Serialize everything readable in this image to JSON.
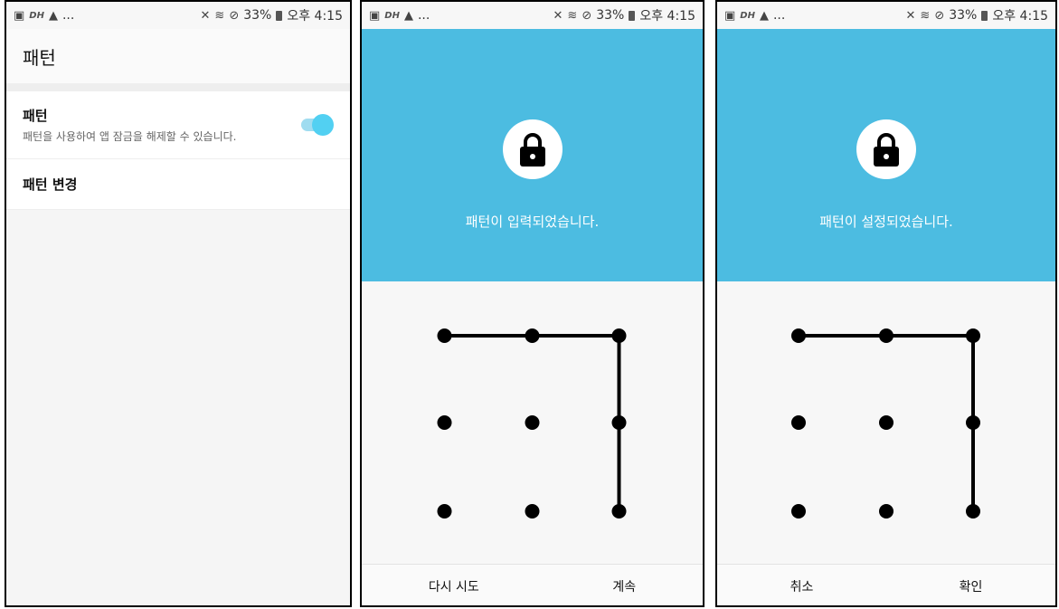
{
  "status_bar": {
    "left_icons": [
      "image-icon",
      "dh-icon",
      "warning-icon"
    ],
    "dh_text": "DH",
    "more": "...",
    "battery": "33%",
    "time": "오후 4:15"
  },
  "screen1": {
    "title": "패턴",
    "pattern_toggle": {
      "title": "패턴",
      "subtitle": "패턴을 사용하여 앱 잠금을 해제할 수 있습니다.",
      "enabled": true
    },
    "change_pattern": "패턴 변경"
  },
  "screen2": {
    "message": "패턴이 입력되었습니다.",
    "retry_button": "다시 시도",
    "continue_button": "계속",
    "pattern": [
      1,
      2,
      3,
      6,
      9
    ]
  },
  "screen3": {
    "message": "패턴이 설정되었습니다.",
    "cancel_button": "취소",
    "confirm_button": "확인",
    "pattern": [
      1,
      2,
      3,
      6,
      9
    ]
  },
  "colors": {
    "accent": "#4cbce1",
    "toggle": "#52d0f2"
  }
}
